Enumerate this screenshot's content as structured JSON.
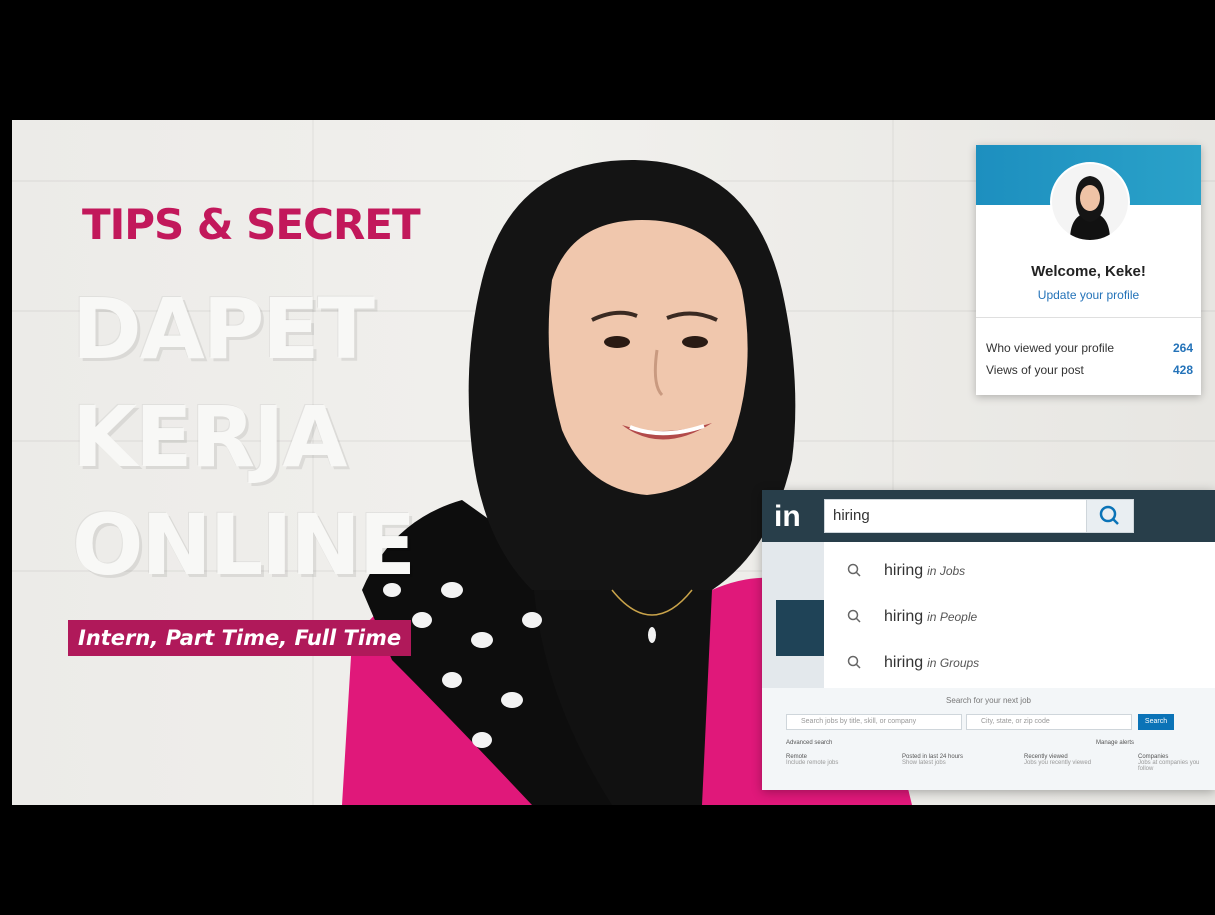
{
  "headline": {
    "tips": "TIPS & SECRET",
    "line1": "DAPET",
    "line2": "KERJA",
    "line3": "ONLINE",
    "tagline": "Intern, Part Time, Full Time"
  },
  "profile_card": {
    "welcome": "Welcome, Keke!",
    "update_link": "Update your profile",
    "stats": [
      {
        "label": "Who viewed your profile",
        "value": "264"
      },
      {
        "label": "Views of your post",
        "value": "428"
      }
    ]
  },
  "linkedin": {
    "logo": "in",
    "search_value": "hiring",
    "suggestions": [
      {
        "term": "hiring",
        "scope": "in Jobs"
      },
      {
        "term": "hiring",
        "scope": "in People"
      },
      {
        "term": "hiring",
        "scope": "in Groups"
      }
    ],
    "jobs": {
      "title": "Search for your next job",
      "keyword_placeholder": "Search jobs by title, skill, or company",
      "location_placeholder": "City, state, or zip code",
      "search_label": "Search",
      "advanced_label": "Advanced search",
      "manage_alerts_label": "Manage alerts",
      "filters": [
        {
          "label": "Remote",
          "sub": "Include remote jobs"
        },
        {
          "label": "Posted in last 24 hours",
          "sub": "Show latest jobs"
        },
        {
          "label": "Recently viewed",
          "sub": "Jobs you recently viewed"
        },
        {
          "label": "Companies",
          "sub": "Jobs at companies you follow"
        }
      ]
    }
  },
  "colors": {
    "accent_pink": "#c2185b",
    "linkedin_navy": "#283e4a",
    "linkedin_blue": "#2473b9"
  }
}
